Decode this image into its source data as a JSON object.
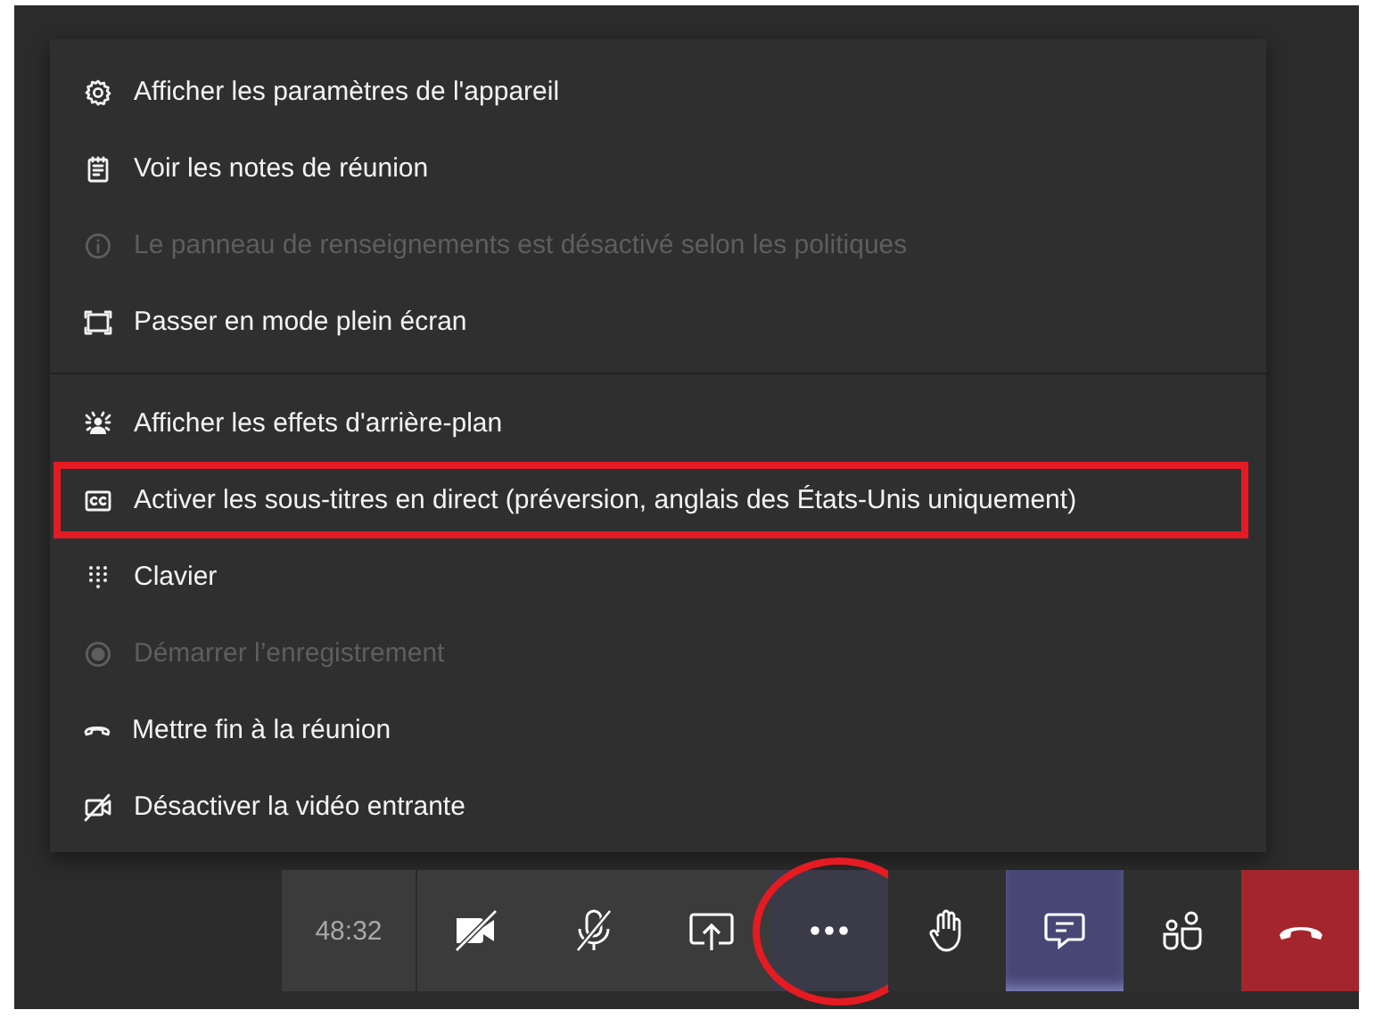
{
  "menu": {
    "sections": [
      {
        "items": [
          {
            "kind": "settings",
            "label": "Afficher les paramètres de l'appareil",
            "disabled": false,
            "annotated": false
          },
          {
            "kind": "notes",
            "label": "Voir les notes de réunion",
            "disabled": false,
            "annotated": false
          },
          {
            "kind": "info",
            "label": "Le panneau de renseignements est désactivé selon les politiques",
            "disabled": true,
            "annotated": false
          },
          {
            "kind": "fullscreen",
            "label": "Passer en mode plein écran",
            "disabled": false,
            "annotated": false
          }
        ]
      },
      {
        "items": [
          {
            "kind": "background",
            "label": "Afficher les effets d'arrière-plan",
            "disabled": false,
            "annotated": false
          },
          {
            "kind": "captions",
            "label": "Activer les sous-titres en direct (préversion, anglais des États-Unis uniquement)",
            "disabled": false,
            "annotated": true
          },
          {
            "kind": "keypad",
            "label": "Clavier",
            "disabled": false,
            "annotated": false
          },
          {
            "kind": "record",
            "label": "Démarrer l’enregistrement",
            "disabled": true,
            "annotated": false
          },
          {
            "kind": "hangup",
            "label": "Mettre fin à la réunion",
            "disabled": false,
            "annotated": false
          },
          {
            "kind": "video-off",
            "label": "Désactiver la vidéo entrante",
            "disabled": false,
            "annotated": false
          }
        ]
      }
    ]
  },
  "toolbar": {
    "timer": "48:32",
    "buttons": [
      {
        "kind": "camera-off",
        "selected": false,
        "annotated": false
      },
      {
        "kind": "mic-off",
        "selected": false,
        "annotated": false
      },
      {
        "kind": "share",
        "selected": false,
        "annotated": false
      },
      {
        "kind": "more",
        "selected": true,
        "annotated": true
      },
      {
        "kind": "hand",
        "selected": false,
        "annotated": false
      },
      {
        "kind": "chat",
        "selected": true,
        "annotated": false
      },
      {
        "kind": "people",
        "selected": false,
        "annotated": false
      },
      {
        "kind": "leave",
        "selected": false,
        "annotated": false
      }
    ]
  }
}
